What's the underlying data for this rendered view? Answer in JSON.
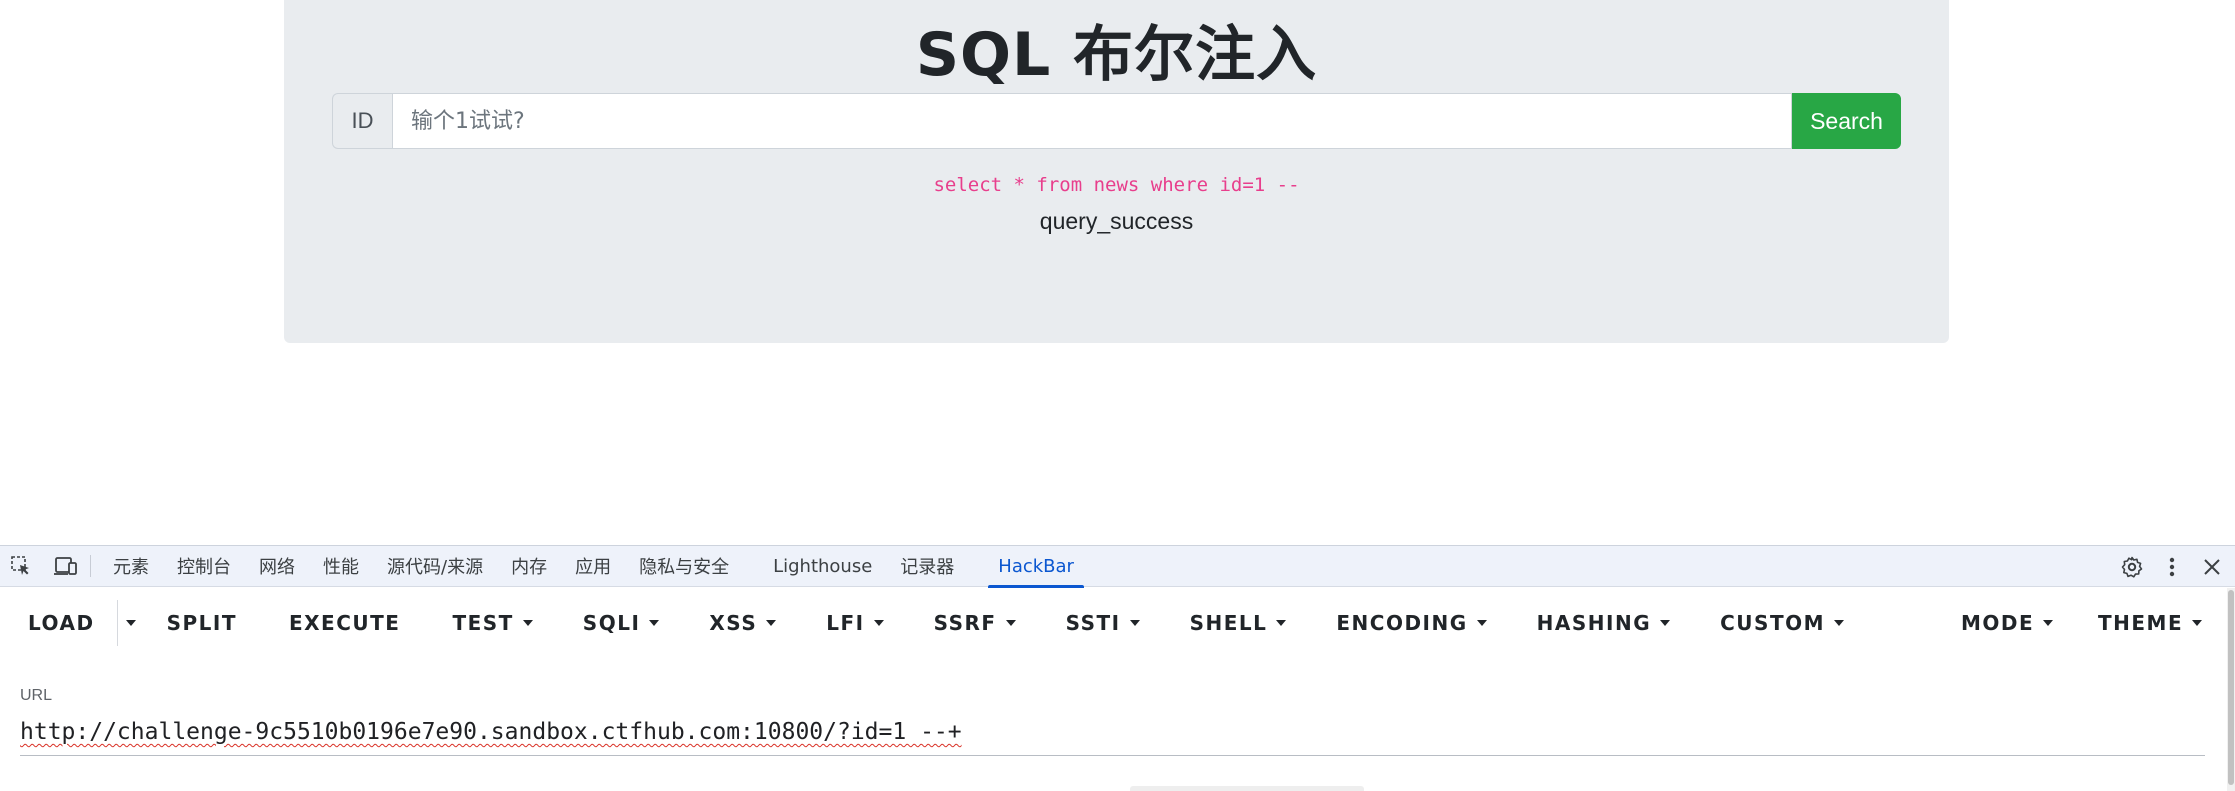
{
  "page": {
    "title": "SQL 布尔注入",
    "id_label": "ID",
    "search_placeholder": "输个1试试?",
    "search_button": "Search",
    "sql_query": "select * from news where id=1 --",
    "result": "query_success"
  },
  "devtools": {
    "tabs": [
      "元素",
      "控制台",
      "网络",
      "性能",
      "源代码/来源",
      "内存",
      "应用",
      "隐私与安全",
      "Lighthouse",
      "记录器",
      "HackBar"
    ],
    "active_tab": "HackBar",
    "icons": [
      "inspect-element-icon",
      "device-toolbar-icon",
      "settings-gear-icon",
      "more-vert-icon",
      "close-icon"
    ]
  },
  "hackbar": {
    "buttons": [
      {
        "label": "LOAD",
        "dropdown": false
      },
      {
        "label": "SPLIT",
        "dropdown": false
      },
      {
        "label": "EXECUTE",
        "dropdown": false
      },
      {
        "label": "TEST",
        "dropdown": true
      },
      {
        "label": "SQLI",
        "dropdown": true
      },
      {
        "label": "XSS",
        "dropdown": true
      },
      {
        "label": "LFI",
        "dropdown": true
      },
      {
        "label": "SSRF",
        "dropdown": true
      },
      {
        "label": "SSTI",
        "dropdown": true
      },
      {
        "label": "SHELL",
        "dropdown": true
      },
      {
        "label": "ENCODING",
        "dropdown": true
      },
      {
        "label": "HASHING",
        "dropdown": true
      },
      {
        "label": "CUSTOM",
        "dropdown": true
      },
      {
        "label": "MODE",
        "dropdown": true
      },
      {
        "label": "THEME",
        "dropdown": true
      }
    ],
    "url_label": "URL",
    "url_value": "http://challenge-9c5510b0196e7e90.sandbox.ctfhub.com:10800/?id=1 --+"
  }
}
